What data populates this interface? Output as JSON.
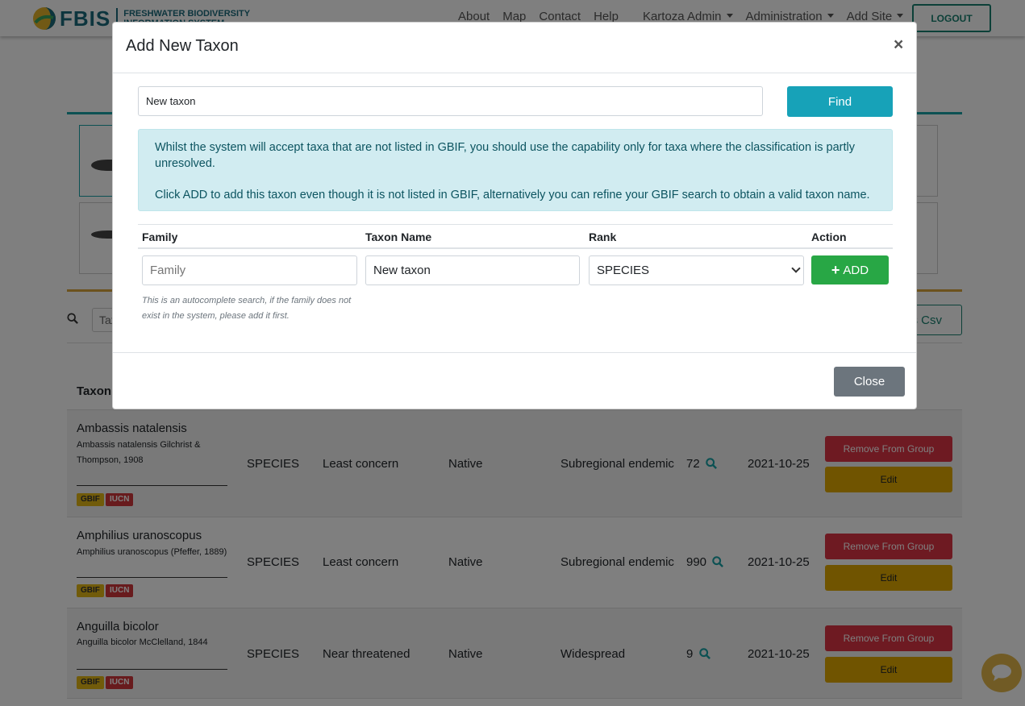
{
  "navbar": {
    "brand_short": "FBIS",
    "brand_line1": "FRESHWATER BIODIVERSITY",
    "brand_line2": "INFORMATION SYSTEM",
    "links": [
      "About",
      "Map",
      "Contact",
      "Help"
    ],
    "user_menu": "Kartoza  Admin",
    "admin_menu": "Administration",
    "add_site_menu": "Add Site",
    "logout": "LOGOUT"
  },
  "search": {
    "placeholder": "Tax",
    "csv_button": "s Csv"
  },
  "table": {
    "taxon_header": "Taxon l",
    "rows": [
      {
        "name": "Ambassis natalensis",
        "author": "Ambassis natalensis Gilchrist & Thompson, 1908",
        "gbif": "GBIF",
        "iucn": "IUCN",
        "rank": "SPECIES",
        "conservation": "Least concern",
        "origin": "Native",
        "endemism": "Subregional endemic",
        "occurrences": "72",
        "date": "2021-10-25",
        "remove": "Remove From Group",
        "edit": "Edit"
      },
      {
        "name": "Amphilius uranoscopus",
        "author": "Amphilius uranoscopus (Pfeffer, 1889)",
        "gbif": "GBIF",
        "iucn": "IUCN",
        "rank": "SPECIES",
        "conservation": "Least concern",
        "origin": "Native",
        "endemism": "Subregional endemic",
        "occurrences": "990",
        "date": "2021-10-25",
        "remove": "Remove From Group",
        "edit": "Edit"
      },
      {
        "name": "Anguilla bicolor",
        "author": "Anguilla bicolor McClelland, 1844",
        "gbif": "GBIF",
        "iucn": "IUCN",
        "rank": "SPECIES",
        "conservation": "Near threatened",
        "origin": "Native",
        "endemism": "Widespread",
        "occurrences": "9",
        "date": "2021-10-25",
        "remove": "Remove From Group",
        "edit": "Edit"
      }
    ]
  },
  "modal": {
    "title": "Add New Taxon",
    "close_x": "×",
    "find_value": "New taxon",
    "find_button": "Find",
    "alert_line1": "Whilst the system will accept taxa that are not listed in GBIF, you should use the capability only for taxa where the classification is partly unresolved.",
    "alert_line2": "Click ADD to add this taxon even though it is not listed in GBIF, alternatively you can refine your GBIF search to obtain a valid taxon name.",
    "columns": {
      "family": "Family",
      "taxon_name": "Taxon Name",
      "rank": "Rank",
      "action": "Action"
    },
    "family_placeholder": "Family",
    "taxon_name_value": "New taxon",
    "rank_value": "SPECIES",
    "add_button": "ADD",
    "help_text": "This is an autocomplete search, if the family does not exist in the system, please add it first.",
    "close_button": "Close"
  },
  "colors": {
    "brand": "#1a6b7c",
    "find_button": "#17a2b8",
    "add_button": "#28a745",
    "close_button": "#6c757d",
    "remove_button": "#dc3545",
    "edit_button": "#e0a800",
    "alert_bg": "#d1ecf1"
  },
  "icons": {
    "search": "search-icon",
    "plus": "plus-icon",
    "chat": "chat-icon",
    "close": "close-icon"
  }
}
